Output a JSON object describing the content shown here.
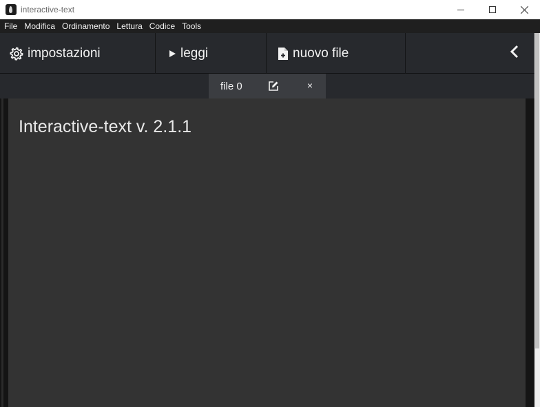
{
  "window": {
    "title": "interactive-text",
    "controls": [
      "minimize",
      "maximize",
      "close"
    ]
  },
  "menu": {
    "items": [
      "File",
      "Modifica",
      "Ordinamento",
      "Lettura",
      "Codice",
      "Tools"
    ]
  },
  "toolbar": {
    "settings_label": "impostazioni",
    "read_label": "leggi",
    "new_file_label": "nuovo file",
    "icons": {
      "settings": "gear-icon",
      "read": "play-icon",
      "new_file": "file-plus-icon",
      "back": "chevron-left-icon"
    }
  },
  "tabs": [
    {
      "label": "file 0",
      "close": "×"
    }
  ],
  "content": {
    "title": "Interactive-text v. 2.1.1"
  },
  "colors": {
    "background": "#1f2124",
    "toolbar": "#27292d",
    "active_tab": "#3b3d41",
    "content": "#333333",
    "text": "#f2f2f2"
  }
}
